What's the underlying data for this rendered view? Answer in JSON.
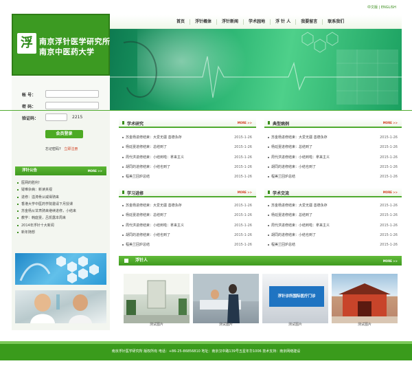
{
  "header": {
    "lang_cn": "中文版",
    "lang_sep": "|",
    "lang_en": "ENGLISH",
    "nav": [
      "首页",
      "浮针概体",
      "浮针新闻",
      "学术园地",
      "浮 针 人",
      "我要留言",
      "联系我们"
    ],
    "logo_lines": [
      "南京浮针医学研究所",
      "南京中医药大学"
    ],
    "logo_glyph": "浮"
  },
  "login": {
    "username_label": "帐  号：",
    "password_label": "密  码：",
    "captcha_label": "验证码：",
    "captcha_value": "2215",
    "login_button": "会员登录",
    "forgot_link": "忘记密码?",
    "register_link": "立即注册"
  },
  "notice": {
    "title": "浮针公告",
    "more": "MORE >>",
    "items": [
      "医网的胜利!",
      "疑难杂病：新读夹视",
      "进修：溢涛骨从威得骑来",
      "香港大学中医药学院邀请下月授课",
      "苏金杨从甘肃骑来继续进修，小结来",
      "教学：韩庭雯，吕凯露本周来",
      "2014年浮针十大新闻",
      "新年随想"
    ]
  },
  "panels": [
    {
      "title": "学术研究",
      "more": "MORE >>",
      "items": [
        {
          "t": "苏金杨进修结束：大爱无疆 善德永存",
          "d": "2015-1-26"
        },
        {
          "t": "杨廷雯进修结束：总结到了",
          "d": "2015-1-26"
        },
        {
          "t": "周代洪进修结束：小结到啦：拿来主义",
          "d": "2015-1-26"
        },
        {
          "t": "胡同的进修结束：小结也到了",
          "d": "2015-1-26"
        },
        {
          "t": "程美兰回炉总结",
          "d": "2015-1-26"
        }
      ]
    },
    {
      "title": "典型病例",
      "more": "MORE >>",
      "items": [
        {
          "t": "苏金杨进修结束：大爱无疆 善德永存",
          "d": "2015-1-26"
        },
        {
          "t": "杨廷雯进修结束：总结到了",
          "d": "2015-1-26"
        },
        {
          "t": "周代洪进修结束：小结到啦：拿来主义",
          "d": "2015-1-26"
        },
        {
          "t": "胡同的进修结束：小结也到了",
          "d": "2015-1-26"
        },
        {
          "t": "程美兰回炉总结",
          "d": "2015-1-26"
        }
      ]
    },
    {
      "title": "学习进修",
      "more": "MORE >>",
      "items": [
        {
          "t": "苏金杨进修结束：大爱无疆 善德永存",
          "d": "2015-1-26"
        },
        {
          "t": "杨廷雯进修结束：总结到了",
          "d": "2015-1-26"
        },
        {
          "t": "周代洪进修结束：小结到啦：拿来主义",
          "d": "2015-1-26"
        },
        {
          "t": "胡同的进修结束：小结也到了",
          "d": "2015-1-26"
        },
        {
          "t": "程美兰回炉总结",
          "d": "2015-1-26"
        }
      ]
    },
    {
      "title": "学术交流",
      "more": "MORE >>",
      "items": [
        {
          "t": "苏金杨进修结束：大爱无疆 善德永存",
          "d": "2015-1-26"
        },
        {
          "t": "杨廷雯进修结束：总结到了",
          "d": "2015-1-26"
        },
        {
          "t": "周代洪进修结束：小结到啦：拿来主义",
          "d": "2015-1-26"
        },
        {
          "t": "胡同的进修结束：小结也到了",
          "d": "2015-1-26"
        },
        {
          "t": "程美兰回炉总结",
          "d": "2015-1-26"
        }
      ]
    }
  ],
  "gallery": {
    "title": "浮针人",
    "more": "MORE >>",
    "items": [
      {
        "caption": "测试图片"
      },
      {
        "caption": "测试图片"
      },
      {
        "caption": "测试图片"
      },
      {
        "caption": "测试图片"
      }
    ],
    "sign_text": "浮针诊所国际医疗门诊"
  },
  "footer": {
    "text": "南京浮针医学研究所  版权所有  电话：+86-25-86856810  地址：南京汉中路139号五星年华1006  技术支持：南京网络建设"
  },
  "colors": {
    "brand_green": "#3a9b1c",
    "accent_red": "#d03a1a"
  }
}
